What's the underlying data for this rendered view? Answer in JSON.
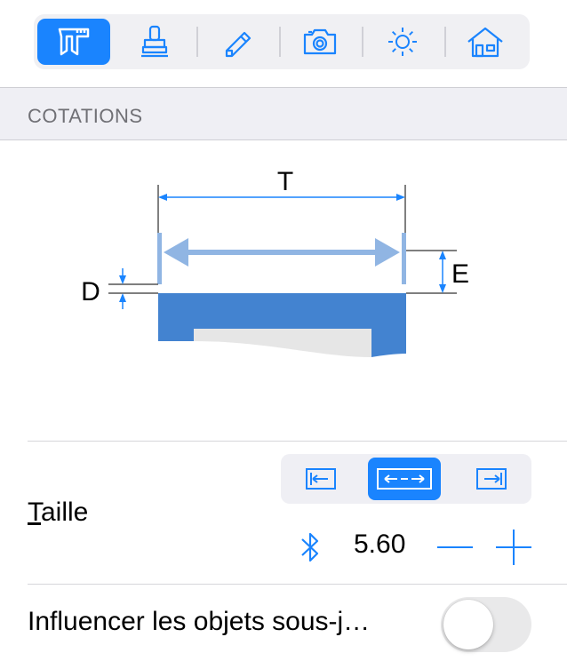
{
  "toolbar": {
    "items": [
      {
        "name": "caliper-icon",
        "active": true
      },
      {
        "name": "stamp-icon",
        "active": false
      },
      {
        "name": "pencil-icon",
        "active": false
      },
      {
        "name": "camera-icon",
        "active": false
      },
      {
        "name": "brightness-icon",
        "active": false
      },
      {
        "name": "home-icon",
        "active": false
      }
    ]
  },
  "section": {
    "title": "COTATIONS"
  },
  "diagram": {
    "label_t": "T",
    "label_d": "D",
    "label_e": "E"
  },
  "taille": {
    "label_first": "T",
    "label_rest": "aille",
    "alignment_options": [
      "align-left-icon",
      "align-center-icon",
      "align-right-icon"
    ],
    "selected_alignment": "align-center-icon",
    "value": "5.60"
  },
  "influencer": {
    "label": "Influencer les objets sous-j…",
    "enabled": false
  },
  "colors": {
    "accent": "#1a84fe",
    "diagram_dark": "#4383d0",
    "diagram_light": "#90b5e3"
  }
}
